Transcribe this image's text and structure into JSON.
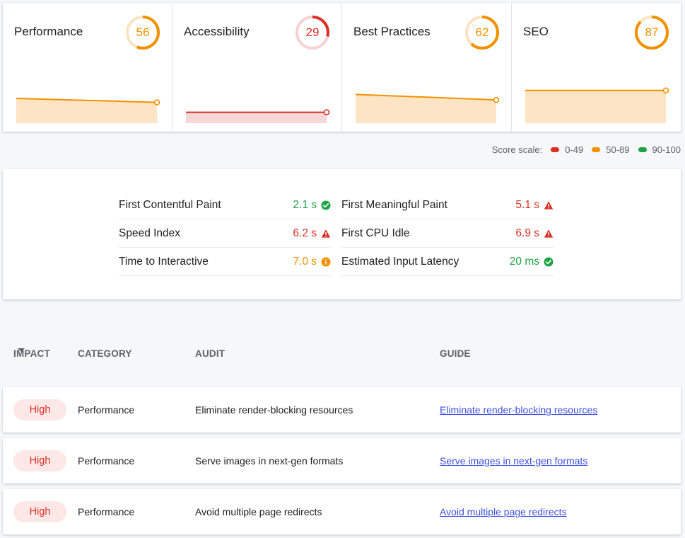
{
  "colors": {
    "fail": "#d93025",
    "average": "#f29100",
    "pass": "#1ea446"
  },
  "categories": [
    {
      "title": "Performance",
      "score": 56,
      "status": "average",
      "trend": [
        0.5,
        0.42
      ]
    },
    {
      "title": "Accessibility",
      "score": 29,
      "status": "fail",
      "trend": [
        0.22,
        0.22
      ]
    },
    {
      "title": "Best Practices",
      "score": 62,
      "status": "average",
      "trend": [
        0.58,
        0.47
      ]
    },
    {
      "title": "SEO",
      "score": 87,
      "status": "average",
      "trend": [
        0.66,
        0.66
      ]
    }
  ],
  "legend": {
    "label": "Score scale:",
    "items": [
      {
        "label": "0-49",
        "status": "fail"
      },
      {
        "label": "50-89",
        "status": "average"
      },
      {
        "label": "90-100",
        "status": "pass"
      }
    ]
  },
  "metrics": {
    "left": [
      {
        "label": "First Contentful Paint",
        "value": "2.1 s",
        "status": "pass"
      },
      {
        "label": "Speed Index",
        "value": "6.2 s",
        "status": "fail"
      },
      {
        "label": "Time to Interactive",
        "value": "7.0 s",
        "status": "average"
      }
    ],
    "right": [
      {
        "label": "First Meaningful Paint",
        "value": "5.1 s",
        "status": "fail"
      },
      {
        "label": "First CPU Idle",
        "value": "6.9 s",
        "status": "fail"
      },
      {
        "label": "Estimated Input Latency",
        "value": "20 ms",
        "status": "pass"
      }
    ]
  },
  "table": {
    "headers": {
      "impact": "IMPACT",
      "category": "CATEGORY",
      "audit": "AUDIT",
      "guide": "GUIDE"
    },
    "rows": [
      {
        "impact": "High",
        "category": "Performance",
        "audit": "Eliminate render-blocking resources",
        "guide": "Eliminate render-blocking resources"
      },
      {
        "impact": "High",
        "category": "Performance",
        "audit": "Serve images in next-gen formats",
        "guide": "Serve images in next-gen formats"
      },
      {
        "impact": "High",
        "category": "Performance",
        "audit": "Avoid multiple page redirects",
        "guide": "Avoid multiple page redirects"
      }
    ]
  }
}
